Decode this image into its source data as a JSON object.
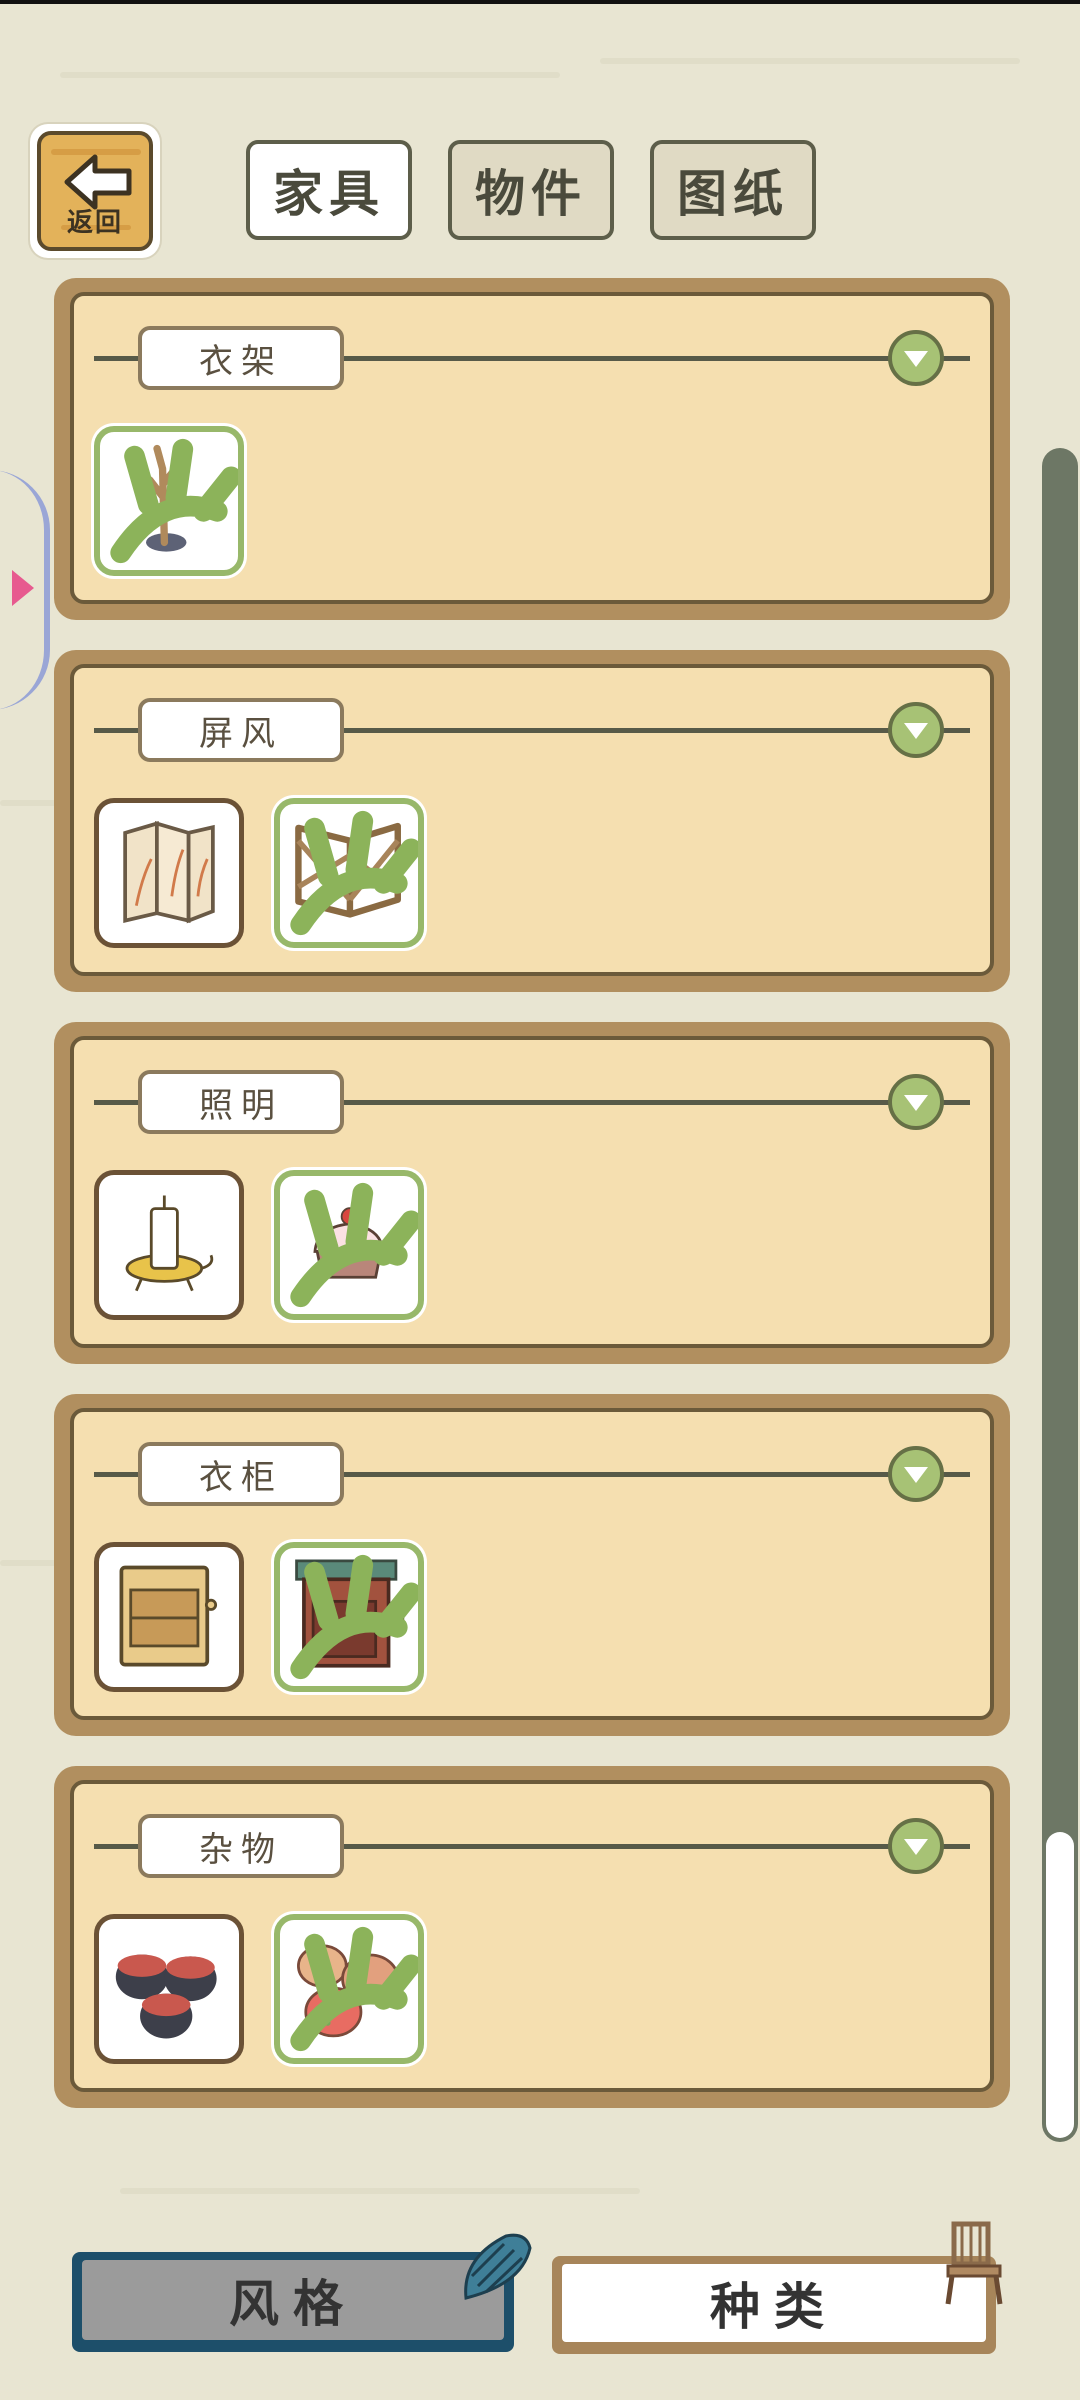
{
  "header": {
    "back_label": "返回",
    "tabs": [
      {
        "label": "家具",
        "active": true
      },
      {
        "label": "物件",
        "active": false
      },
      {
        "label": "图纸",
        "active": false
      }
    ]
  },
  "categories": [
    {
      "label": "衣架",
      "items": [
        {
          "icon": "coat-rack-icon",
          "style": "green"
        }
      ]
    },
    {
      "label": "屏风",
      "items": [
        {
          "icon": "folding-screen-icon",
          "style": "brown"
        },
        {
          "icon": "lattice-screen-icon",
          "style": "green"
        }
      ]
    },
    {
      "label": "照明",
      "items": [
        {
          "icon": "candle-icon",
          "style": "brown"
        },
        {
          "icon": "cake-lamp-icon",
          "style": "green"
        }
      ]
    },
    {
      "label": "衣柜",
      "items": [
        {
          "icon": "wood-cabinet-icon",
          "style": "brown"
        },
        {
          "icon": "red-cabinet-icon",
          "style": "green"
        }
      ]
    },
    {
      "label": "杂物",
      "items": [
        {
          "icon": "jars-icon",
          "style": "brown"
        },
        {
          "icon": "sacks-icon",
          "style": "green"
        }
      ]
    }
  ],
  "footer": {
    "style_label": "风格",
    "kind_label": "种类"
  },
  "colors": {
    "background": "#e8e5d2",
    "panel_frame": "#b18f5f",
    "panel_fill": "#f5dfb0",
    "accent_green": "#98b86a",
    "style_button": "#1d4f6a"
  }
}
